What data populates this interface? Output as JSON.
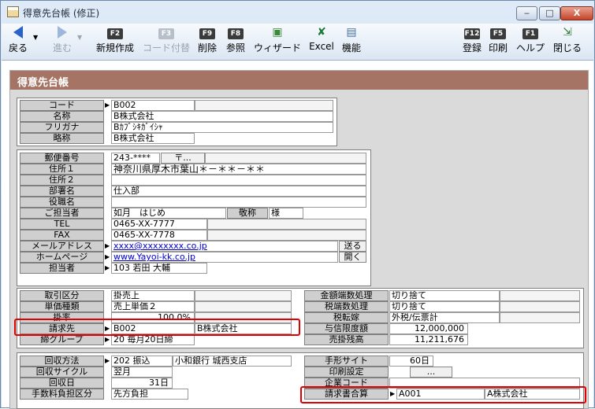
{
  "window": {
    "title": "得意先台帳 (修正)",
    "min": "‒",
    "max": "□",
    "close": "X"
  },
  "toolbar": {
    "back": "戻る",
    "forward": "進む",
    "new_key": "F2",
    "new": "新規作成",
    "code_key": "F3",
    "code": "コード付替",
    "del_key": "F9",
    "del": "削除",
    "ref_key": "F8",
    "ref": "参照",
    "wizard": "ウィザード",
    "excel": "Excel",
    "func": "機能",
    "reg_key": "F12",
    "reg": "登録",
    "print_key": "F5",
    "print": "印刷",
    "help_key": "F1",
    "help": "ヘルプ",
    "close": "閉じる"
  },
  "panel": {
    "title": "得意先台帳"
  },
  "basic": {
    "code_l": "コード",
    "code_v": "B002",
    "name_l": "名称",
    "name_v": "B株式会社",
    "kana_l": "フリガナ",
    "kana_v": "Bｶﾌﾞｼｷｶﾞｲｼｬ",
    "short_l": "略称",
    "short_v": "B株式会社"
  },
  "address": {
    "zip_l": "郵便番号",
    "zip_v": "243-****",
    "zip_btn": "〒...",
    "addr1_l": "住所１",
    "addr1_v": "神奈川県厚木市葉山＊－＊＊－＊＊",
    "addr2_l": "住所２",
    "addr2_v": "",
    "dept_l": "部署名",
    "dept_v": "仕入部",
    "post_l": "役職名",
    "post_v": "",
    "person_l": "ご担当者",
    "person_v": "如月　はじめ",
    "honor_l": "敬称",
    "honor_v": "様",
    "tel_l": "TEL",
    "tel_v": "0465-XX-7777",
    "fax_l": "FAX",
    "fax_v": "0465-XX-7778",
    "mail_l": "メールアドレス",
    "mail_v": "xxxx@xxxxxxxx.co.jp",
    "mail_btn": "送る",
    "home_l": "ホームページ",
    "home_v": "www.Yayoi-kk.co.jp",
    "home_btn": "開く",
    "staff_l": "担当者",
    "staff_v": "103 若田 大輔"
  },
  "trade": {
    "kind_l": "取引区分",
    "kind_v": "掛売上",
    "price_l": "単価種類",
    "price_v": "売上単価２",
    "rate_l": "掛率",
    "rate_v": "100.0%",
    "bill_l": "請求先",
    "bill_code": "B002",
    "bill_name": "B株式会社",
    "group_l": "締グループ",
    "group_v": "20 毎月20日締",
    "round_l": "金額端数処理",
    "round_v": "切り捨て",
    "taxround_l": "税端数処理",
    "taxround_v": "切り捨て",
    "taxmode_l": "税転嫁",
    "taxmode_v": "外税/伝票計",
    "credit_l": "与信限度額",
    "credit_v": "12,000,000",
    "balance_l": "売掛残高",
    "balance_v": "11,211,676"
  },
  "collect": {
    "method_l": "回収方法",
    "method_v": "202 振込",
    "bank_v": "小和銀行 城西支店",
    "cycle_l": "回収サイクル",
    "cycle_v": "翌月",
    "day_l": "回収日",
    "day_v": "31日",
    "fee_l": "手数料負担区分",
    "fee_v": "先方負担",
    "site_l": "手形サイト",
    "site_v": "60日",
    "print_l": "印刷設定",
    "print_btn": "...",
    "corp_l": "企業コード",
    "corp_v": "",
    "merge_l": "請求書合算",
    "merge_code": "A001",
    "merge_name": "A株式会社"
  },
  "colors": {
    "panel_header": "#a57464",
    "highlight": "#e00000",
    "link": "#0000cc"
  }
}
